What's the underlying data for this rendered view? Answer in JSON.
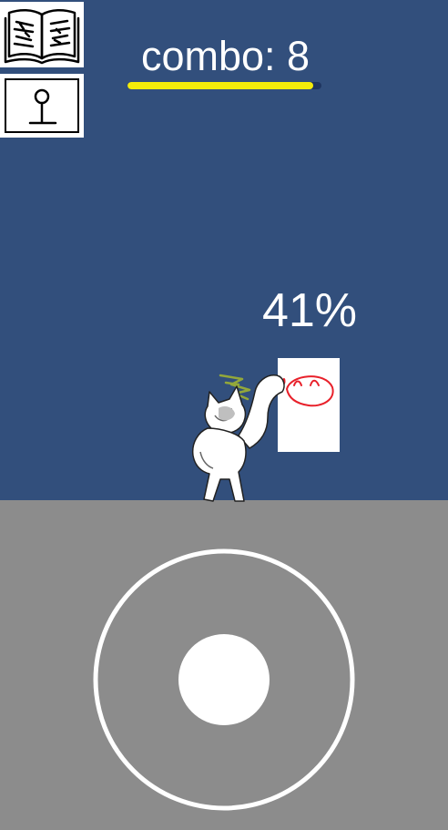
{
  "hud": {
    "combo_text": "combo: 8",
    "combo_meter_fraction": 0.96,
    "combo_meter_color": "#f4ec0a",
    "progress_text": "41%"
  },
  "toolbar": {
    "book_icon": "open-book-icon",
    "controls_icon": "joystick-icon"
  },
  "scene": {
    "sky_color": "#324f7c",
    "ground_color": "#8c8c8c",
    "target_face_color": "#e8202a",
    "sparkle_color": "#93a83a"
  },
  "controls": {
    "joystick_ring_color": "#ffffff",
    "joystick_knob_color": "#ffffff"
  }
}
